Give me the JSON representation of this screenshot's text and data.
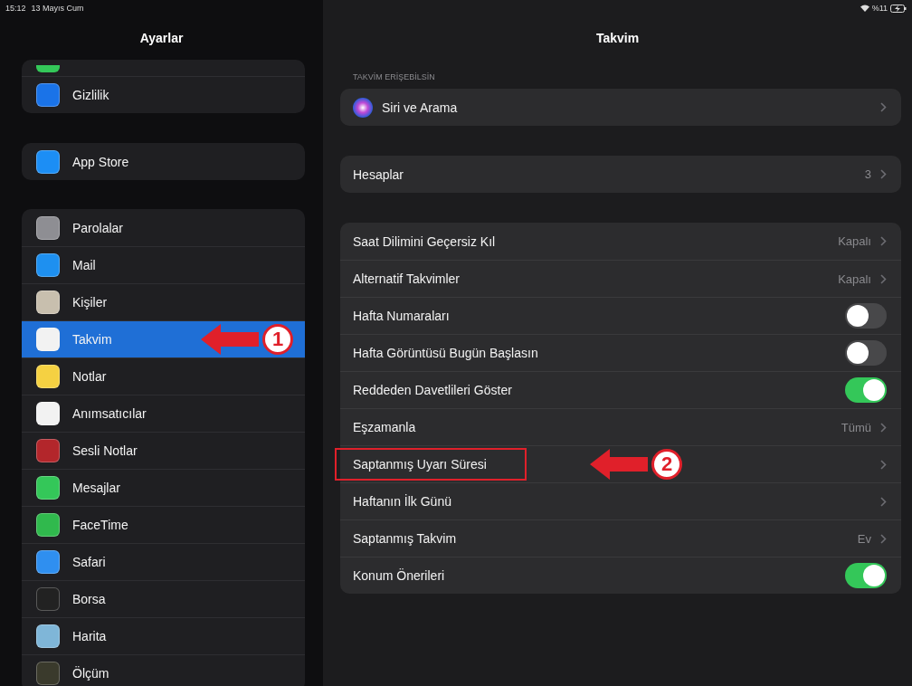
{
  "status_bar": {
    "time": "15:12",
    "date": "13 Mayıs Cum",
    "battery": "%11"
  },
  "sidebar": {
    "title": "Ayarlar",
    "groups": [
      {
        "items": [
          {
            "kind": "cut_off",
            "color": "#34c759",
            "selected": false
          },
          {
            "label": "Gizlilik",
            "color": "#1a73e8",
            "selected": false
          }
        ]
      },
      {
        "items": [
          {
            "label": "App Store",
            "color": "#1c8ef5",
            "selected": false
          }
        ]
      },
      {
        "items": [
          {
            "label": "Parolalar",
            "color": "#8e8e93",
            "selected": false
          },
          {
            "label": "Mail",
            "color": "#1e90f0",
            "selected": false
          },
          {
            "label": "Kişiler",
            "color": "#c8bfae",
            "selected": false
          },
          {
            "label": "Takvim",
            "color": "#f2f2f2",
            "selected": true,
            "annotation": "1"
          },
          {
            "label": "Notlar",
            "color": "#f5d142",
            "selected": false
          },
          {
            "label": "Anımsatıcılar",
            "color": "#f2f2f2",
            "selected": false
          },
          {
            "label": "Sesli Notlar",
            "color": "#b3262b",
            "selected": false
          },
          {
            "label": "Mesajlar",
            "color": "#34c759",
            "selected": false
          },
          {
            "label": "FaceTime",
            "color": "#30b94d",
            "selected": false
          },
          {
            "label": "Safari",
            "color": "#2f8ff0",
            "selected": false
          },
          {
            "label": "Borsa",
            "color": "#222222",
            "selected": false
          },
          {
            "label": "Harita",
            "color": "#7fb6d8",
            "selected": false
          },
          {
            "label": "Ölçüm",
            "color": "#3a3a2c",
            "selected": false
          }
        ]
      }
    ]
  },
  "detail": {
    "title": "Takvim",
    "groups": [
      {
        "header": "TAKVİM ERİŞEBİLSİN",
        "rows": [
          {
            "kind": "link",
            "label": "Siri ve Arama",
            "icon": true
          }
        ]
      },
      {
        "rows": [
          {
            "kind": "link",
            "label": "Hesaplar",
            "value": "3"
          }
        ]
      },
      {
        "rows": [
          {
            "kind": "link",
            "label": "Saat Dilimini Geçersiz Kıl",
            "value": "Kapalı"
          },
          {
            "kind": "link",
            "label": "Alternatif Takvimler",
            "value": "Kapalı"
          },
          {
            "kind": "toggle",
            "label": "Hafta Numaraları",
            "on": false
          },
          {
            "kind": "toggle",
            "label": "Hafta Görüntüsü Bugün Başlasın",
            "on": false
          },
          {
            "kind": "toggle",
            "label": "Reddeden Davetlileri Göster",
            "on": true
          },
          {
            "kind": "link",
            "label": "Eşzamanla",
            "value": "Tümü"
          },
          {
            "kind": "link",
            "label": "Saptanmış Uyarı Süresi",
            "highlighted": true,
            "annotation": "2"
          },
          {
            "kind": "link",
            "label": "Haftanın İlk Günü"
          },
          {
            "kind": "link",
            "label": "Saptanmış Takvim",
            "value": "Ev"
          },
          {
            "kind": "toggle",
            "label": "Konum Önerileri",
            "on": true
          }
        ]
      }
    ]
  }
}
